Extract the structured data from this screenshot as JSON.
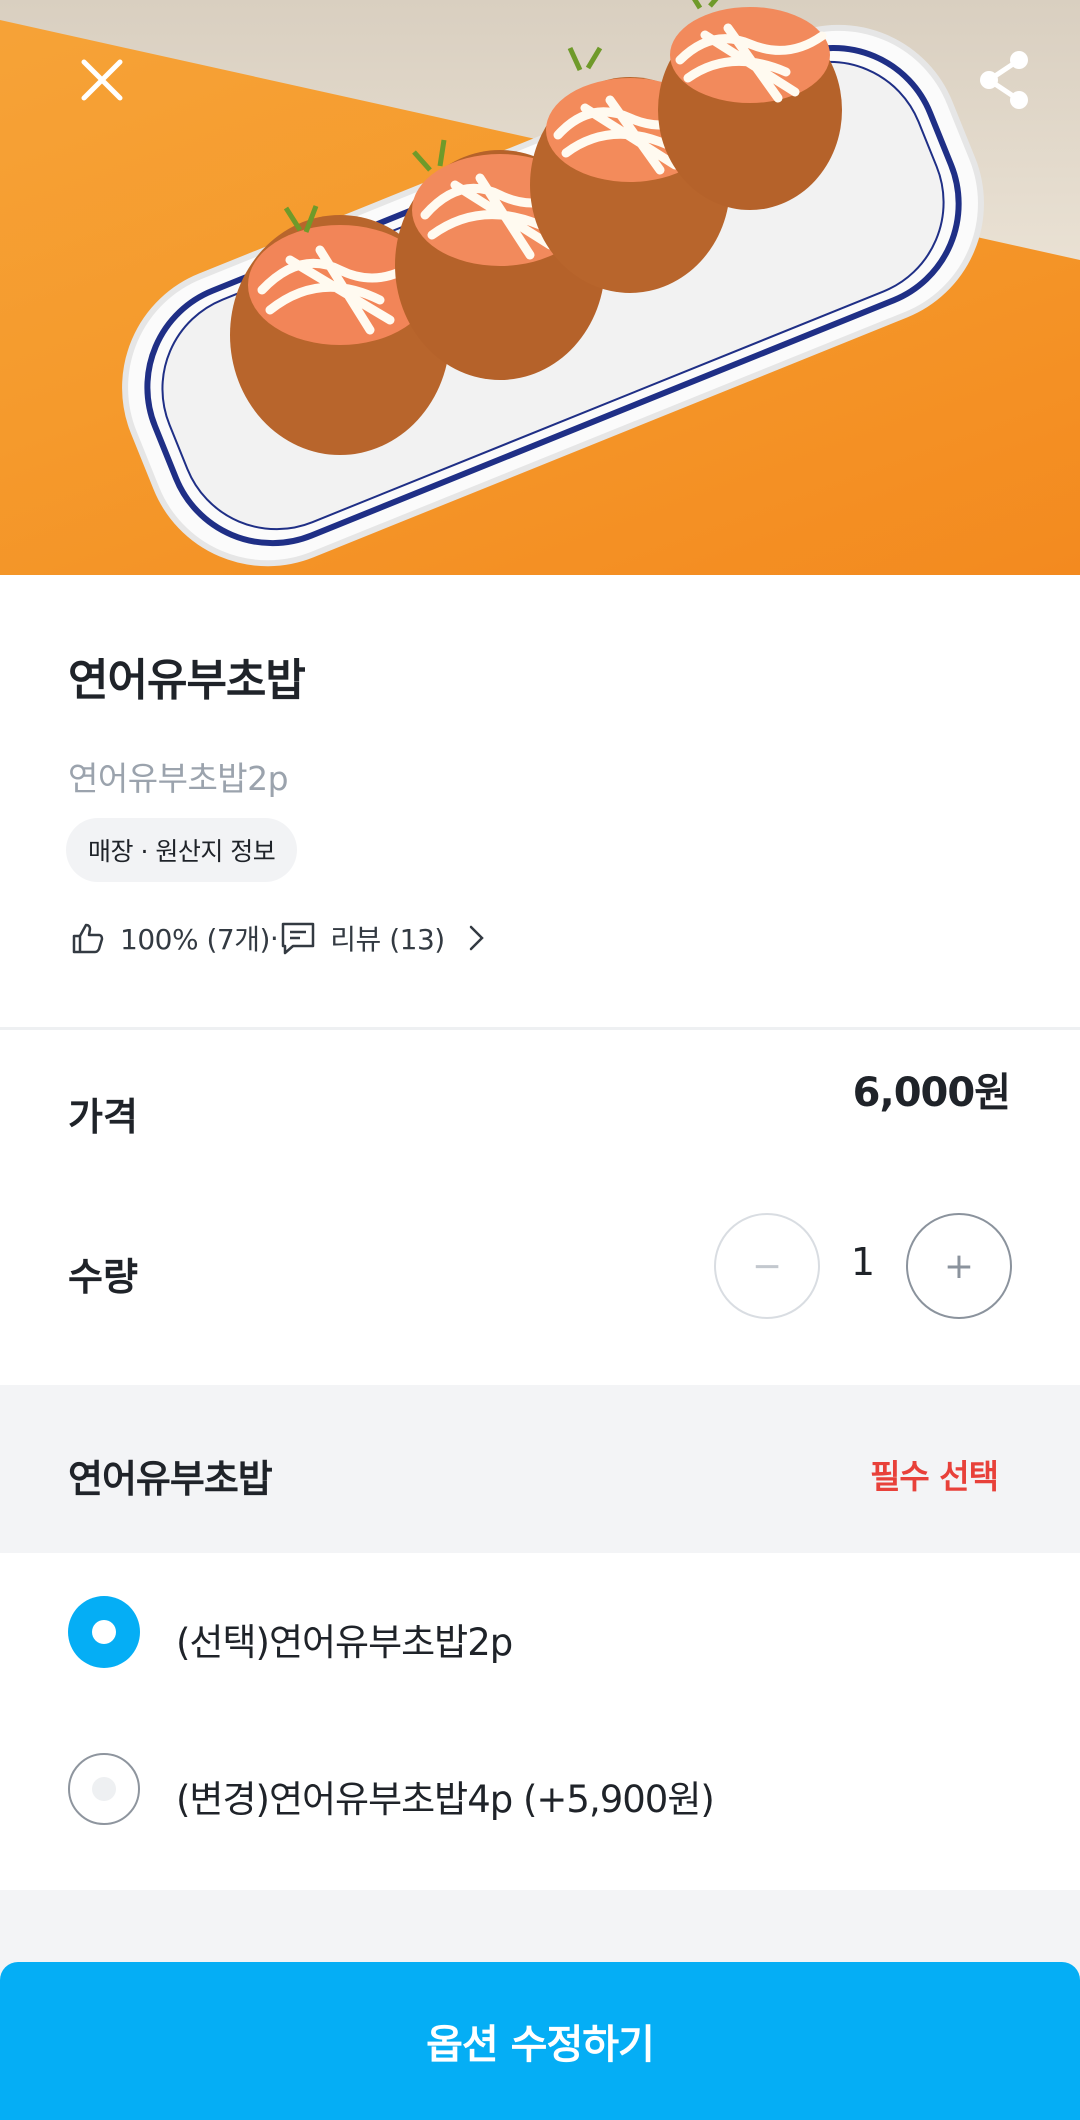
{
  "hero": {
    "image_subject": "salmon inari sushi on white oval plate",
    "close_icon": "close-icon",
    "share_icon": "share-icon"
  },
  "product": {
    "title": "연어유부초밥",
    "subtitle": "연어유부초밥2p",
    "info_chip": "매장 · 원산지 정보",
    "like_rate": "100% (7개)",
    "separator": "·",
    "review_label": "리뷰 (13)"
  },
  "price": {
    "label": "가격",
    "value": "6,000원"
  },
  "quantity": {
    "label": "수량",
    "minus": "−",
    "value": "1",
    "plus": "+"
  },
  "option_group": {
    "title": "연어유부초밥",
    "required": "필수 선택",
    "options": [
      {
        "label": "(선택)연어유부초밥2p",
        "selected": true
      },
      {
        "label": "(변경)연어유부초밥4p (+5,900원)",
        "selected": false
      }
    ]
  },
  "cta": {
    "label": "옵션 수정하기"
  },
  "colors": {
    "primary": "#05aef5",
    "required": "#e8413a",
    "muted_text": "#9ba3ad",
    "section_bg": "#f3f4f6"
  }
}
